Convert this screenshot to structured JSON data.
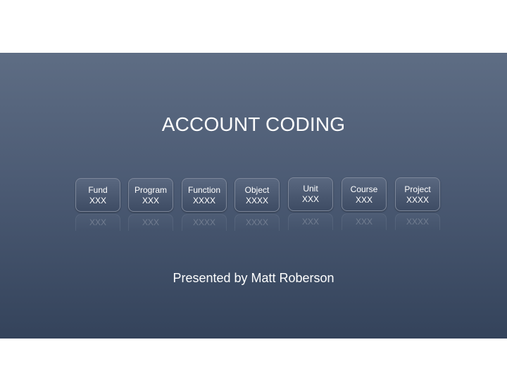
{
  "slide": {
    "title": "ACCOUNT CODING",
    "subtitle": "Presented by Matt Roberson",
    "segments": [
      {
        "label": "Fund",
        "code": "XXX"
      },
      {
        "label": "Program",
        "code": "XXX"
      },
      {
        "label": "Function",
        "code": "XXXX"
      },
      {
        "label": "Object",
        "code": "XXXX"
      },
      {
        "label": "Unit",
        "code": "XXX"
      },
      {
        "label": "Course",
        "code": "XXX"
      },
      {
        "label": "Project",
        "code": "XXXX"
      }
    ]
  },
  "colors": {
    "background_top": "#5e6d84",
    "background_bottom": "#34435b",
    "text": "#ffffff"
  }
}
